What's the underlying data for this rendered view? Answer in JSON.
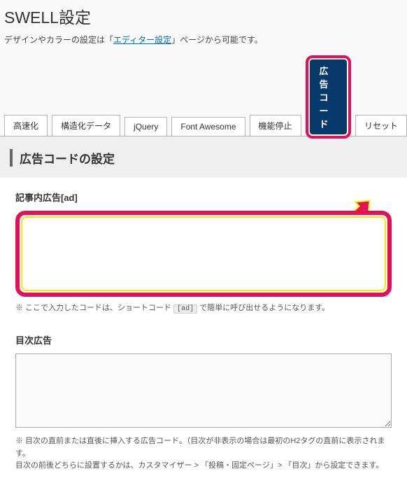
{
  "page": {
    "title": "SWELL設定",
    "subtitle_prefix": "デザインやカラーの設定は「",
    "subtitle_link": "エディター設定",
    "subtitle_suffix": "」ページから可能です。"
  },
  "tabs": {
    "items": [
      {
        "label": "高速化"
      },
      {
        "label": "構造化データ"
      },
      {
        "label": "jQuery"
      },
      {
        "label": "Font Awesome"
      },
      {
        "label": "機能停止"
      },
      {
        "label": "広告コード"
      },
      {
        "label": "リセット"
      }
    ],
    "active_index": 5
  },
  "section": {
    "heading": "広告コードの設定"
  },
  "fields": {
    "ad_in_article": {
      "label": "記事内広告[ad]",
      "value": "",
      "help_prefix": "※ ここで入力したコードは、ショートコード ",
      "help_code": "[ad]",
      "help_suffix": " で簡単に呼び出せるようになります。"
    },
    "toc_ad": {
      "label": "目次広告",
      "value": "",
      "help_line1": "※ 目次の直前または直後に挿入する広告コード。（目次が非表示の場合は最初のH2タグの直前に表示されます。",
      "help_line2": "目次の前後どちらに設置するかは、カスタマイザー > 「投稿・固定ページ」> 「目次」から設定できます。"
    }
  }
}
